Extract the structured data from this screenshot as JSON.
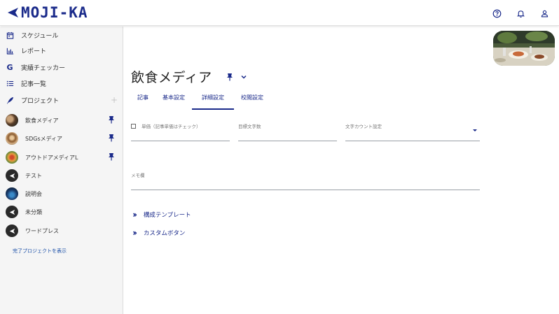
{
  "app": {
    "logo_text": "MOJI-KA"
  },
  "header": {
    "icons": [
      "help-circle-icon",
      "bell-icon",
      "user-icon"
    ]
  },
  "sidebar": {
    "nav": [
      {
        "label": "スケジュール",
        "icon": "calendar-icon"
      },
      {
        "label": "レポート",
        "icon": "bar-chart-icon"
      },
      {
        "label": "実績チェッカー",
        "icon": "google-icon"
      },
      {
        "label": "記事一覧",
        "icon": "list-icon"
      },
      {
        "label": "プロジェクト",
        "icon": "rocket-icon"
      }
    ],
    "add_symbol": "+",
    "projects": [
      {
        "label": "飲食メディア",
        "pinned": true
      },
      {
        "label": "SDGsメディア",
        "pinned": true
      },
      {
        "label": "アウトドアメディアL",
        "pinned": true
      },
      {
        "label": "テスト",
        "pinned": false
      },
      {
        "label": "説明会",
        "pinned": false
      },
      {
        "label": "未分類",
        "pinned": false
      },
      {
        "label": "ワードプレス",
        "pinned": false
      }
    ],
    "show_completed": "完了プロジェクトを表示"
  },
  "main": {
    "title": "飲食メディア",
    "tabs": [
      {
        "label": "記事",
        "active": false
      },
      {
        "label": "基本設定",
        "active": false
      },
      {
        "label": "詳細設定",
        "active": true
      },
      {
        "label": "校閲設定",
        "active": false
      }
    ],
    "fields": {
      "unit_price_label": "単価（記事単価はチェック）",
      "target_chars_label": "目標文字数",
      "char_count_label": "文字カウント設定",
      "memo_label": "メモ欄"
    },
    "sections": [
      {
        "label": "構成テンプレート"
      },
      {
        "label": "カスタムボタン"
      }
    ]
  },
  "colors": {
    "accent": "#1a2a8a",
    "sidebar_bg": "#f5f5f5"
  }
}
